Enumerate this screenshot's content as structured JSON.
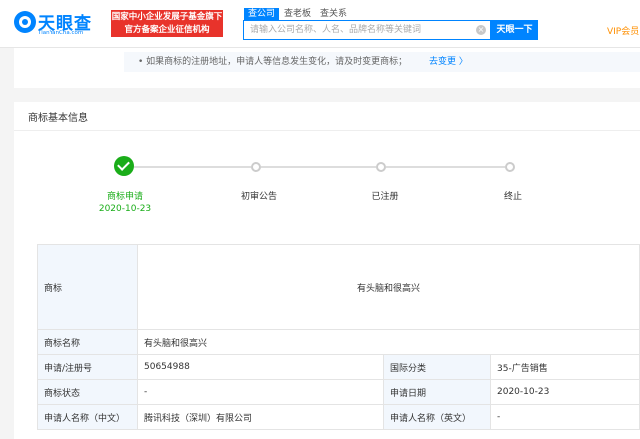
{
  "header": {
    "logo_text": "天眼查",
    "logo_sub": "TianYanCha.com",
    "banner_line1": "国家中小企业发展子基金旗下",
    "banner_line2": "官方备案企业征信机构",
    "tabs": [
      {
        "label": "查公司",
        "active": true
      },
      {
        "label": "查老板",
        "active": false
      },
      {
        "label": "查关系",
        "active": false
      }
    ],
    "search_placeholder": "请输入公司名称、人名、品牌名称等关键词",
    "search_button": "天眼一下",
    "vip": "VIP会员"
  },
  "notice": {
    "text": "• 如果商标的注册地址，申请人等信息发生变化，请及时变更商标；",
    "link": "去变更 〉"
  },
  "section": {
    "title": "商标基本信息"
  },
  "steps": [
    {
      "label": "商标申请",
      "date": "2020-10-23",
      "done": true
    },
    {
      "label": "初审公告",
      "date": "",
      "done": false
    },
    {
      "label": "已注册",
      "date": "",
      "done": false
    },
    {
      "label": "终止",
      "date": "",
      "done": false
    }
  ],
  "table": {
    "trademark_label": "商标",
    "trademark_image_text": "有头脑和很高兴",
    "name_label": "商标名称",
    "name_value": "有头脑和很高兴",
    "reg_no_label": "申请/注册号",
    "reg_no_value": "50654988",
    "class_label": "国际分类",
    "class_value": "35-广告销售",
    "status_label": "商标状态",
    "status_value": "-",
    "apply_date_label": "申请日期",
    "apply_date_value": "2020-10-23",
    "applicant_cn_label": "申请人名称（中文）",
    "applicant_cn_value": "腾讯科技（深圳）有限公司",
    "applicant_en_label": "申请人名称（英文）",
    "applicant_en_value": "-"
  },
  "colors": {
    "brand": "#0084ff",
    "banner": "#e8332b",
    "success": "#1aad19",
    "vip": "#ff8f00"
  }
}
